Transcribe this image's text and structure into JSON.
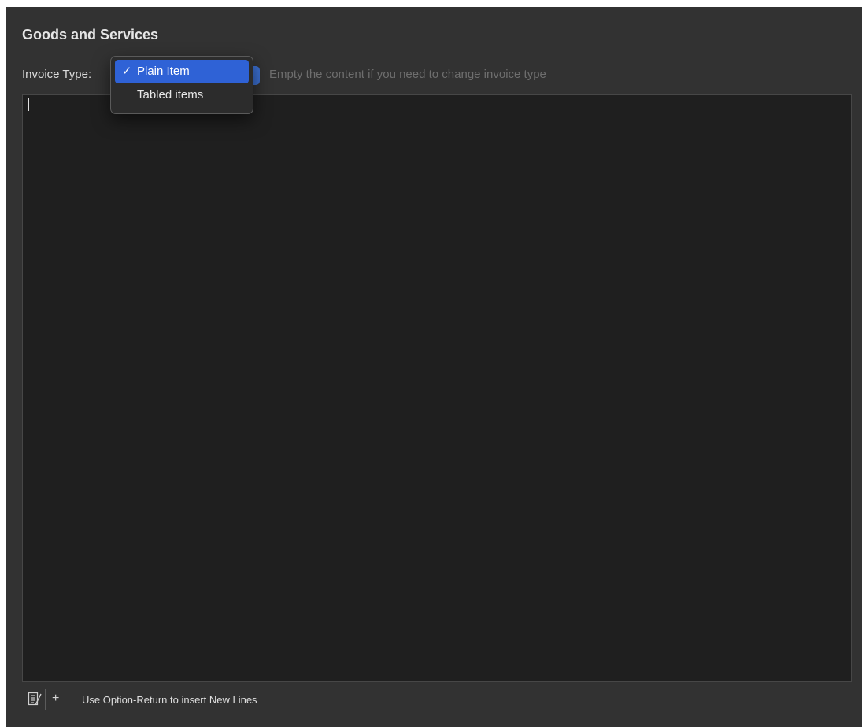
{
  "section": {
    "title": "Goods and Services"
  },
  "invoice_type": {
    "label": "Invoice Type:",
    "hint": "Empty the content if you need to change invoice type",
    "options": [
      {
        "label": "Plain Item",
        "checked": true,
        "check_mark": "✓"
      },
      {
        "label": "Tabled items",
        "checked": false,
        "check_mark": ""
      }
    ]
  },
  "editor": {
    "content": ""
  },
  "footer": {
    "plus_label": "+",
    "note": "Use Option-Return to insert New Lines"
  },
  "colors": {
    "panel_bg": "#323232",
    "editor_bg": "#1f1f1f",
    "selection_accent": "#2f62d6",
    "hint_text": "#6e6e6e"
  },
  "icons": {
    "tool": "edit-list-icon",
    "add": "plus-icon",
    "check": "checkmark-icon"
  }
}
